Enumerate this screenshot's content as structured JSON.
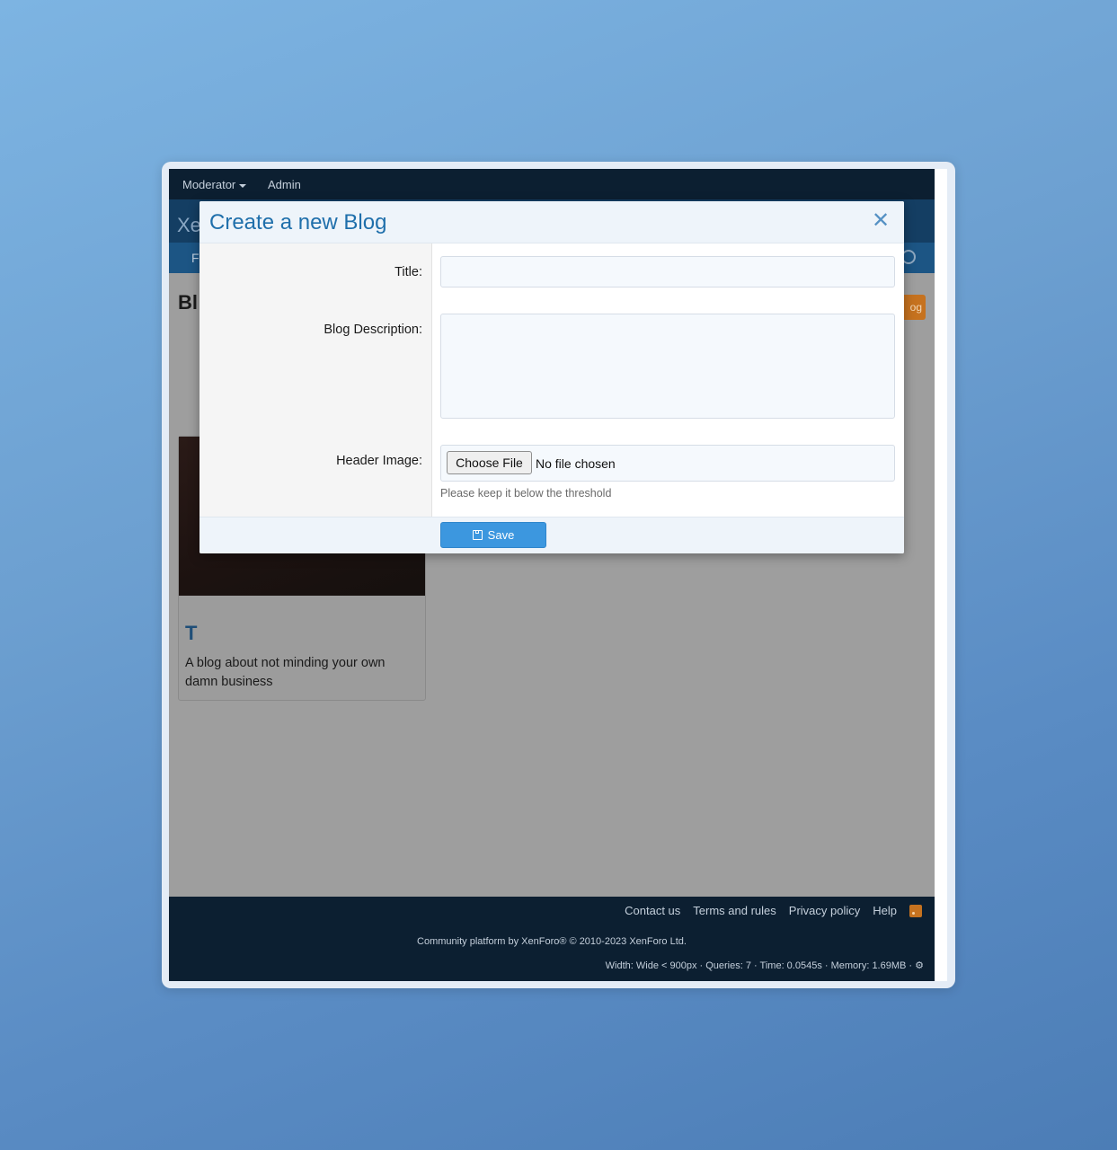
{
  "topnav": {
    "moderator": "Moderator",
    "admin": "Admin"
  },
  "header": {
    "logo": "Xe",
    "nav_fragment": "F"
  },
  "content": {
    "heading_fragment": "Bl",
    "action_fragment": "og",
    "card": {
      "title_fragment": "T",
      "description": "A blog about not minding your own damn business"
    }
  },
  "modal": {
    "title": "Create a new Blog",
    "close": "✕",
    "fields": {
      "title_label": "Title:",
      "title_value": "",
      "description_label": "Blog Description:",
      "description_value": "",
      "header_image_label": "Header Image:",
      "choose_file": "Choose File",
      "no_file": "No file chosen",
      "hint": "Please keep it below the threshold"
    },
    "save_label": "Save"
  },
  "footer": {
    "links": [
      "Contact us",
      "Terms and rules",
      "Privacy policy",
      "Help"
    ],
    "copyright": "Community platform by XenForo® © 2010-2023 XenForo Ltd.",
    "debug": "Width: Wide < 900px · Queries: 7 · Time: 0.0545s · Memory: 1.69MB · ⚙"
  }
}
